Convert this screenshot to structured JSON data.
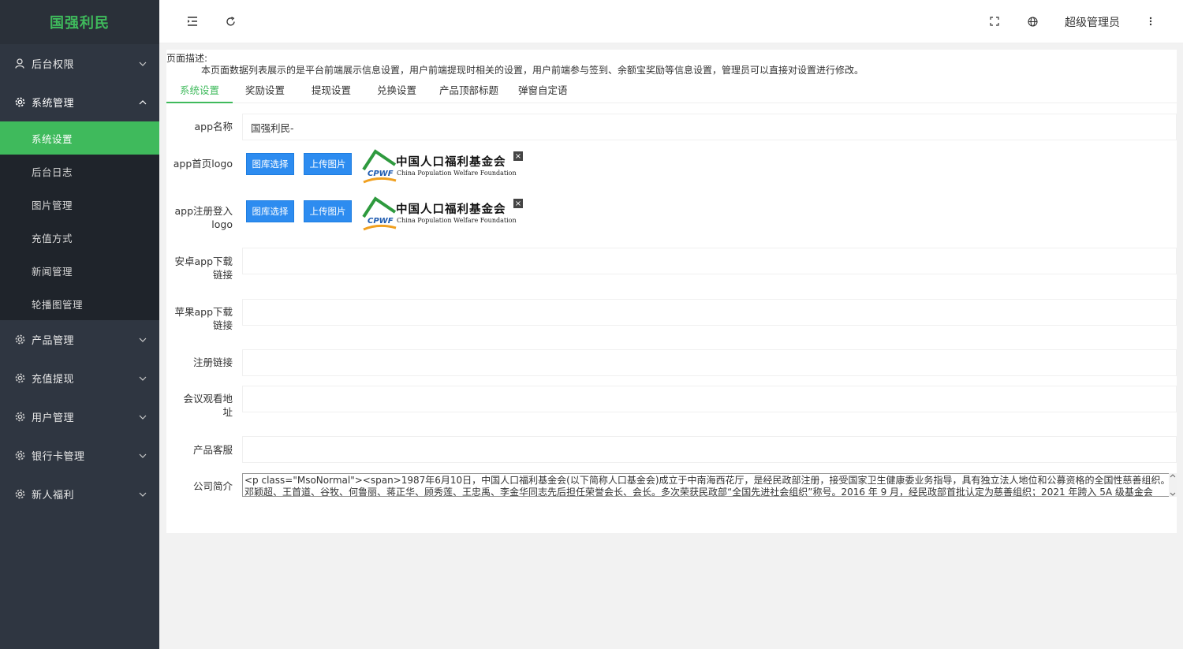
{
  "app": {
    "brand": "国强利民"
  },
  "sidebar": {
    "groups": [
      {
        "label": "后台权限",
        "icon": "user-icon",
        "expanded": false
      },
      {
        "label": "系统管理",
        "icon": "gear-icon",
        "expanded": true,
        "items": [
          {
            "label": "系统设置",
            "active": true
          },
          {
            "label": "后台日志"
          },
          {
            "label": "图片管理"
          },
          {
            "label": "充值方式"
          },
          {
            "label": "新闻管理"
          },
          {
            "label": "轮播图管理"
          }
        ]
      },
      {
        "label": "产品管理",
        "icon": "gear-icon",
        "expanded": false
      },
      {
        "label": "充值提现",
        "icon": "gear-icon",
        "expanded": false
      },
      {
        "label": "用户管理",
        "icon": "gear-icon",
        "expanded": false
      },
      {
        "label": "银行卡管理",
        "icon": "gear-icon",
        "expanded": false
      },
      {
        "label": "新人福利",
        "icon": "gear-icon",
        "expanded": false
      }
    ]
  },
  "header": {
    "admin_name": "超级管理员",
    "icons": [
      "menu-fold-icon",
      "refresh-icon",
      "fullscreen-icon",
      "globe-icon",
      "more-icon"
    ]
  },
  "page": {
    "desc_title": "页面描述:",
    "desc_text": "本页面数据列表展示的是平台前端展示信息设置，用户前端提现时相关的设置，用户前端参与签到、余额宝奖励等信息设置，管理员可以直接对设置进行修改。",
    "tabs": [
      "系统设置",
      "奖励设置",
      "提现设置",
      "兑换设置",
      "产品顶部标题",
      "弹窗自定语"
    ],
    "active_tab": "系统设置"
  },
  "form": {
    "app_name_label": "app名称",
    "app_name_value": "国强利民-",
    "home_logo_label": "app首页logo",
    "login_logo_label_1": "app注册登入",
    "login_logo_label_2": "logo",
    "btn_gallery": "图库选择",
    "btn_upload": "上传图片",
    "logo_cn": "中国人口福利基金会",
    "logo_en": "China Population Welfare Foundation",
    "logo_abbr": "CPWF",
    "android_label_1": "安卓app下载",
    "android_label_2": "链接",
    "android_value": "",
    "ios_label_1": "苹果app下载",
    "ios_label_2": "链接",
    "ios_value": "",
    "register_label": "注册链接",
    "register_value": "",
    "meeting_label_1": "会议观看地",
    "meeting_label_2": "址",
    "meeting_value": "",
    "service_label": "产品客服",
    "service_value": "",
    "company_label": "公司简介",
    "company_line_1": "<p class=\"MsoNormal\"><span>1987年6月10日，中国人口福利基金会(以下简称人口基金会)成立于中南海西花厅，是经民政部注册，接受国家卫生健康委业务指导，具有独立法人地位和公募资格的全国性慈善组织。",
    "company_line_2": "邓颖超、王首道、谷牧、何鲁丽、蒋正华、顾秀莲、王忠禹、李金华同志先后担任荣誉会长、会长。多次荣获民政部“全国先进社会组织”称号。2016 年 9 月，经民政部首批认定为慈善组织；2021 年跨入 5A 级基金会"
  }
}
